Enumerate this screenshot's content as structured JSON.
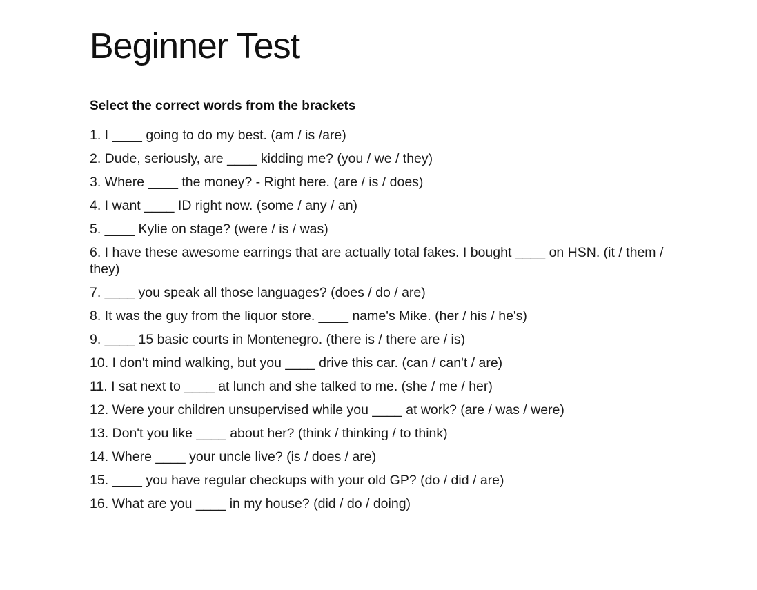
{
  "document": {
    "title": "Beginner Test",
    "instruction": "Select the correct words from the brackets",
    "questions": [
      "1. I ____ going to do my best. (am / is /are)",
      "2. Dude, seriously, are ____ kidding me? (you / we / they)",
      "3. Where ____ the money? - Right here. (are / is / does)",
      "4. I want ____ ID right now. (some / any / an)",
      "5. ____ Kylie on stage? (were / is / was)",
      "6. I have these awesome earrings that are actually total fakes. I bought ____ on HSN. (it / them / they)",
      "7. ____ you speak all those languages? (does / do / are)",
      "8. It was the guy from the liquor store. ____ name's Mike. (her / his / he's)",
      "9. ____ 15 basic courts in Montenegro. (there is / there are / is)",
      "10. I don't mind walking, but you ____ drive this car. (can / can't / are)",
      "11. I sat next to ____ at lunch and she talked to me. (she / me / her)",
      "12. Were your children unsupervised while you ____ at work? (are / was / were)",
      "13. Don't you like ____ about her? (think / thinking / to think)",
      "14. Where ____ your uncle live? (is / does / are)",
      "15. ____ you have regular checkups with your old GP? (do / did / are)",
      "16. What are you ____ in my house? (did / do / doing)"
    ]
  }
}
